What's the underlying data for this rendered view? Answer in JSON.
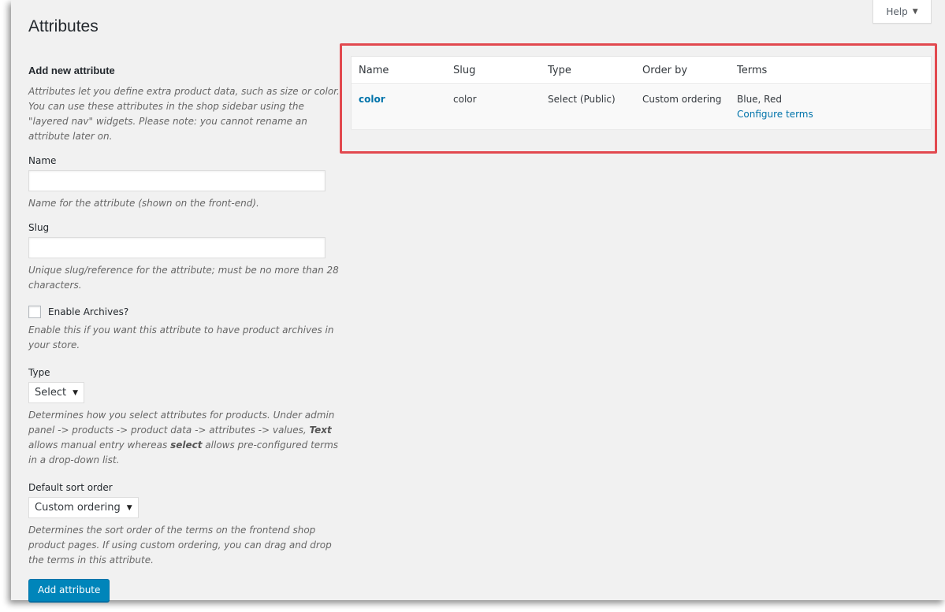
{
  "help": {
    "label": "Help"
  },
  "page": {
    "title": "Attributes"
  },
  "form": {
    "heading": "Add new attribute",
    "intro": "Attributes let you define extra product data, such as size or color. You can use these attributes in the shop sidebar using the \"layered nav\" widgets. Please note: you cannot rename an attribute later on.",
    "name": {
      "label": "Name",
      "value": "",
      "help": "Name for the attribute (shown on the front-end)."
    },
    "slug": {
      "label": "Slug",
      "value": "",
      "help": "Unique slug/reference for the attribute; must be no more than 28 characters."
    },
    "archives": {
      "label": "Enable Archives?",
      "checked": false,
      "help": "Enable this if you want this attribute to have product archives in your store."
    },
    "type": {
      "label": "Type",
      "selected": "Select",
      "help_part1": "Determines how you select attributes for products. Under admin panel -> products -> product data -> attributes -> values, ",
      "help_bold1": "Text",
      "help_part2": " allows manual entry whereas ",
      "help_bold2": "select",
      "help_part3": " allows pre-configured terms in a drop-down list."
    },
    "sort": {
      "label": "Default sort order",
      "selected": "Custom ordering",
      "help": "Determines the sort order of the terms on the frontend shop product pages. If using custom ordering, you can drag and drop the terms in this attribute."
    },
    "submit_label": "Add attribute"
  },
  "table": {
    "columns": [
      "Name",
      "Slug",
      "Type",
      "Order by",
      "Terms"
    ],
    "rows": [
      {
        "name": "color",
        "slug": "color",
        "type": "Select (Public)",
        "order_by": "Custom ordering",
        "terms": "Blue, Red",
        "configure_label": "Configure terms"
      }
    ]
  },
  "colors": {
    "highlight": "#e2494f",
    "primary": "#0085ba",
    "link": "#0073aa",
    "background": "#f1f1f1"
  }
}
